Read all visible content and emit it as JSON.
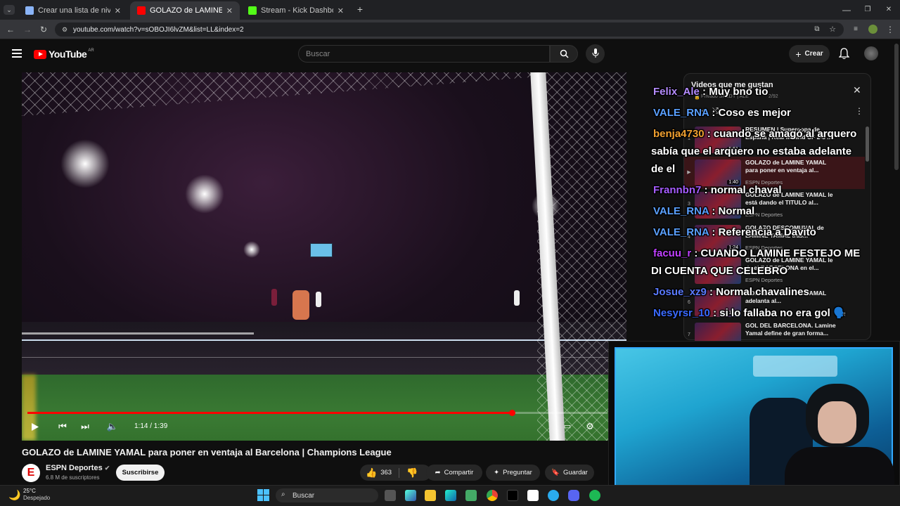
{
  "browser": {
    "tabs": [
      {
        "title": "Crear una lista de niveles de un",
        "favicon_color": "#8ab4f8"
      },
      {
        "title": "GOLAZO de LAMINE YAMAL pa",
        "favicon_color": "#ff0000"
      },
      {
        "title": "Stream - Kick Dashboard",
        "favicon_color": "#53fc18"
      }
    ],
    "new_tab": "+",
    "url": "youtube.com/watch?v=sOBOJI6lvZM&list=LL&index=2",
    "window_controls": [
      "—",
      "❐",
      "✕"
    ]
  },
  "youtube": {
    "logo_text": "YouTube",
    "country": "AR",
    "search_placeholder": "Buscar",
    "create_label": "Crear"
  },
  "player": {
    "current_time": "1:14 / 1:39",
    "progress": 0.835
  },
  "video": {
    "title": "GOLAZO de LAMINE YAMAL para poner en ventaja al Barcelona | Champions League",
    "channel": "ESPN Deportes",
    "channel_initial": "E",
    "subscribers": "6.8 M de suscriptores",
    "subscribe_label": "Suscribirse",
    "likes": "363",
    "share_label": "Compartir",
    "ask_label": "Preguntar",
    "save_label": "Guardar"
  },
  "playlist": {
    "title": "Videos que me gustan",
    "owner": "Privado SKEDY | ALE",
    "count": "2/92",
    "items": [
      {
        "index": "1",
        "title": "RESUMEN | Supercopa de España | Real Madrid CF 2-5 ...",
        "channel": "",
        "duration": "5:51"
      },
      {
        "index": "▶",
        "title": "GOLAZO de LAMINE YAMAL para poner en ventaja al...",
        "channel": "ESPN Deportes",
        "duration": "1:40"
      },
      {
        "index": "3",
        "title": "GOLAZO de LAMINE YAMAL le está dando el TITULO al...",
        "channel": "ESPN Deportes",
        "duration": ""
      },
      {
        "index": "4",
        "title": "GOLAZO DESCOMUNAL de LAMINE YAMAL tras...",
        "channel": "ESPN Deportes",
        "duration": "1:24"
      },
      {
        "index": "5",
        "title": "GOLAZO de LAMINE YAMAL le da el BARCELONA en el...",
        "channel": "ESPN Deportes",
        "duration": ""
      },
      {
        "index": "6",
        "title": "GOLAZO de LAMINE YAMAL adelanta al...",
        "channel": "",
        "duration": "1:31"
      },
      {
        "index": "7",
        "title": "GOL DEL BARCELONA. Lamine Yamal define de gran forma...",
        "channel": "",
        "duration": ""
      }
    ]
  },
  "chat": [
    {
      "user": "Felix_Ale",
      "color": "#b58cff",
      "msg": "Muy bno tio"
    },
    {
      "user": "VALE_RNA",
      "color": "#5aa0ff",
      "msg": "Coso es mejor"
    },
    {
      "user": "benja4730",
      "color": "#f0a030",
      "msg": "cuando se amagó al arquero",
      "cont": [
        "sabía que el arquero no estaba adelante",
        "de el"
      ]
    },
    {
      "user": "Frannbn7",
      "color": "#a55cff",
      "msg": "normal chaval"
    },
    {
      "user": "VALE_RNA",
      "color": "#5aa0ff",
      "msg": "Normal"
    },
    {
      "user": "VALE_RNA",
      "color": "#5aa0ff",
      "msg": "Referencia a Davito"
    },
    {
      "user": "facuu_r",
      "color": "#c040ff",
      "msg": "CUANDO LAMINE FESTEJO ME",
      "cont": [
        "DI CUENTA QUE CELEBRO"
      ]
    },
    {
      "user": "Josue_xz9",
      "color": "#5a7aff",
      "msg": "Normal chavalines"
    },
    {
      "user": "Nesyrsr_10",
      "color": "#3a6aff",
      "msg": "si lo fallaba no era gol 🗣️"
    }
  ],
  "taskbar": {
    "temperature": "25°C",
    "weather": "Despejado",
    "search_label": "Buscar"
  }
}
